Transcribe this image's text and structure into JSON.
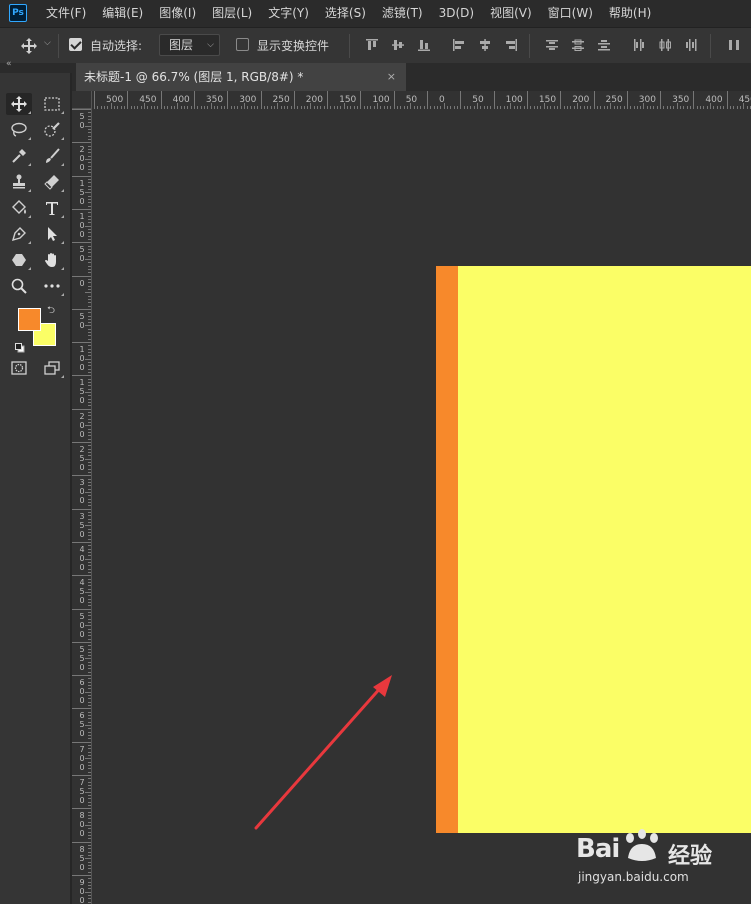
{
  "app": {
    "logo": "Ps"
  },
  "menu": [
    "文件(F)",
    "编辑(E)",
    "图像(I)",
    "图层(L)",
    "文字(Y)",
    "选择(S)",
    "滤镜(T)",
    "3D(D)",
    "视图(V)",
    "窗口(W)",
    "帮助(H)"
  ],
  "options": {
    "auto_select_label": "自动选择:",
    "auto_select_checked": true,
    "layer_select_value": "图层",
    "show_transform_label": "显示变换控件",
    "show_transform_checked": false
  },
  "document_tab": {
    "title": "未标题-1 @ 66.7% (图层 1, RGB/8#) *",
    "close": "×"
  },
  "ruler_top_labels": [
    "500",
    "450",
    "400",
    "350",
    "300",
    "250",
    "200",
    "150",
    "100",
    "50",
    "0",
    "50",
    "100",
    "150",
    "200",
    "250",
    "300",
    "350",
    "400",
    "450"
  ],
  "ruler_left_labels": [
    "5\n0",
    "2\n0\n0",
    "1\n5\n0",
    "1\n0\n0",
    "5\n0",
    "0",
    "5\n0",
    "1\n0\n0",
    "1\n5\n0",
    "2\n0\n0",
    "2\n5\n0",
    "3\n0\n0",
    "3\n5\n0",
    "4\n0\n0",
    "4\n5\n0",
    "5\n0\n0",
    "5\n5\n0",
    "6\n0\n0",
    "6\n5\n0",
    "7\n0\n0",
    "7\n5\n0",
    "8\n0\n0",
    "8\n5\n0",
    "9\n0\n0"
  ],
  "colors": {
    "foreground": "#f7892b",
    "background": "#fbfe66",
    "annotation_arrow": "#e8383d"
  },
  "tools": [
    "move-tool",
    "marquee-tool",
    "lasso-tool",
    "quick-select-tool",
    "eyedropper-tool",
    "brush-tool",
    "stamp-tool",
    "eraser-tool",
    "paint-bucket-tool",
    "type-tool",
    "pen-tool",
    "path-select-tool",
    "shape-tool",
    "hand-tool",
    "zoom-tool",
    "more-tools"
  ],
  "watermark": {
    "brand": "Bai",
    "cn": "经验",
    "url": "jingyan.baidu.com"
  }
}
